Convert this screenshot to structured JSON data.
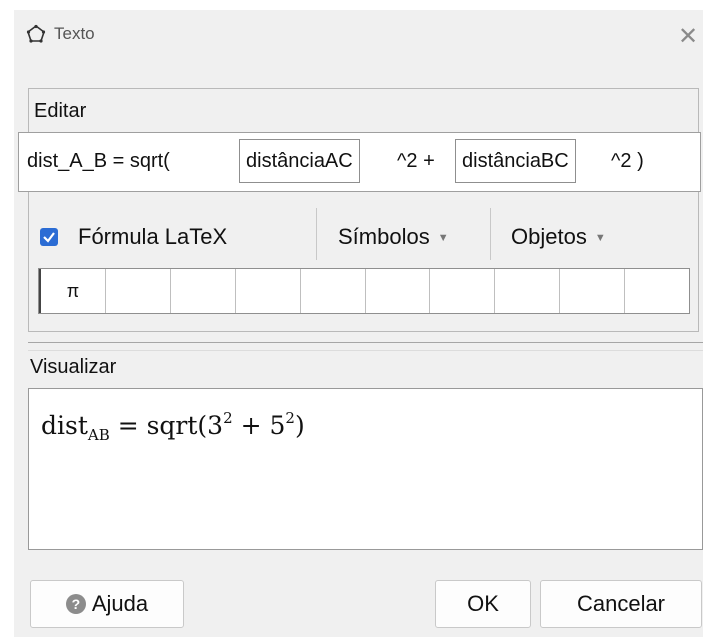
{
  "window": {
    "title": "Texto",
    "icon": "pentagon-icon",
    "close_symbol": "✕"
  },
  "edit_section": {
    "label": "Editar",
    "expression": {
      "prefix": "dist_A_B = sqrt(",
      "field1": "distânciaAC",
      "middle": "^2 +",
      "field2": "distânciaBC",
      "suffix": "^2 )"
    },
    "latex_checkbox": {
      "label": "Fórmula LaTeX",
      "checked": true
    },
    "symbols_dropdown": "Símbolos",
    "objects_dropdown": "Objetos",
    "symbol_cells": [
      "π",
      "",
      "",
      "",
      "",
      "",
      "",
      "",
      "",
      ""
    ]
  },
  "preview_section": {
    "label": "Visualizar",
    "formula": {
      "base": "dist",
      "subscript": "AB",
      "operator": "= sqrt(",
      "a": "3",
      "a_exp": "2",
      "plus": "+",
      "b": "5",
      "b_exp": "2",
      "close": ")"
    }
  },
  "buttons": {
    "help": "Ajuda",
    "ok": "OK",
    "cancel": "Cancelar"
  },
  "colors": {
    "checkbox": "#2b6cd4",
    "dialog_bg": "#f0f0f0"
  }
}
